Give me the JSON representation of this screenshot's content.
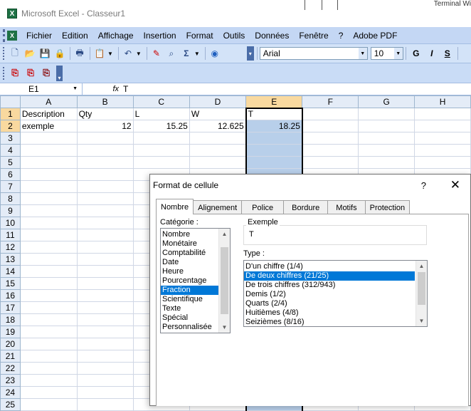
{
  "window": {
    "title": "Microsoft Excel - Classeur1",
    "bg_fragment": "Terminal Wi"
  },
  "menu": [
    "Fichier",
    "Edition",
    "Affichage",
    "Insertion",
    "Format",
    "Outils",
    "Données",
    "Fenêtre",
    "?",
    "Adobe PDF"
  ],
  "toolbar": {
    "font": "Arial",
    "size": "10",
    "bold": "G",
    "italic": "I",
    "underline": "S"
  },
  "formula_bar": {
    "name": "E1",
    "fx": "fx",
    "value": "T"
  },
  "sheet": {
    "columns": [
      "A",
      "B",
      "C",
      "D",
      "E",
      "F",
      "G",
      "H"
    ],
    "selected_column": "E",
    "rows": [
      [
        "Description",
        "Qty",
        "L",
        "W",
        "T",
        "",
        "",
        ""
      ],
      [
        "exemple",
        "12",
        "15.25",
        "12.625",
        "18.25",
        "",
        "",
        ""
      ]
    ],
    "row_numbers": [
      "1",
      "2",
      "3",
      "4",
      "5",
      "6",
      "7",
      "8",
      "9",
      "10",
      "11",
      "12",
      "13",
      "14",
      "15",
      "16",
      "17",
      "18",
      "19",
      "20",
      "21",
      "22",
      "23",
      "24",
      "25"
    ]
  },
  "dialog": {
    "title": "Format de cellule",
    "help": "?",
    "close": "✕",
    "tabs": [
      "Nombre",
      "Alignement",
      "Police",
      "Bordure",
      "Motifs",
      "Protection"
    ],
    "active_tab": "Nombre",
    "category_label": "Catégorie :",
    "categories": [
      "Nombre",
      "Monétaire",
      "Comptabilité",
      "Date",
      "Heure",
      "Pourcentage",
      "Fraction",
      "Scientifique",
      "Texte",
      "Spécial",
      "Personnalisée"
    ],
    "selected_category": "Fraction",
    "sample_label": "Exemple",
    "sample_value": "T",
    "type_label": "Type :",
    "types": [
      "D'un chiffre (1/4)",
      "De deux chiffres (21/25)",
      "De trois chiffres (312/943)",
      "Demis (1/2)",
      "Quarts (2/4)",
      "Huitièmes (4/8)",
      "Seizièmes (8/16)"
    ],
    "selected_type": "De deux chiffres (21/25)"
  },
  "colors": {
    "menubar": "#c4d7f4",
    "selection": "#0078d7",
    "header_selected": "#f9d99f"
  }
}
